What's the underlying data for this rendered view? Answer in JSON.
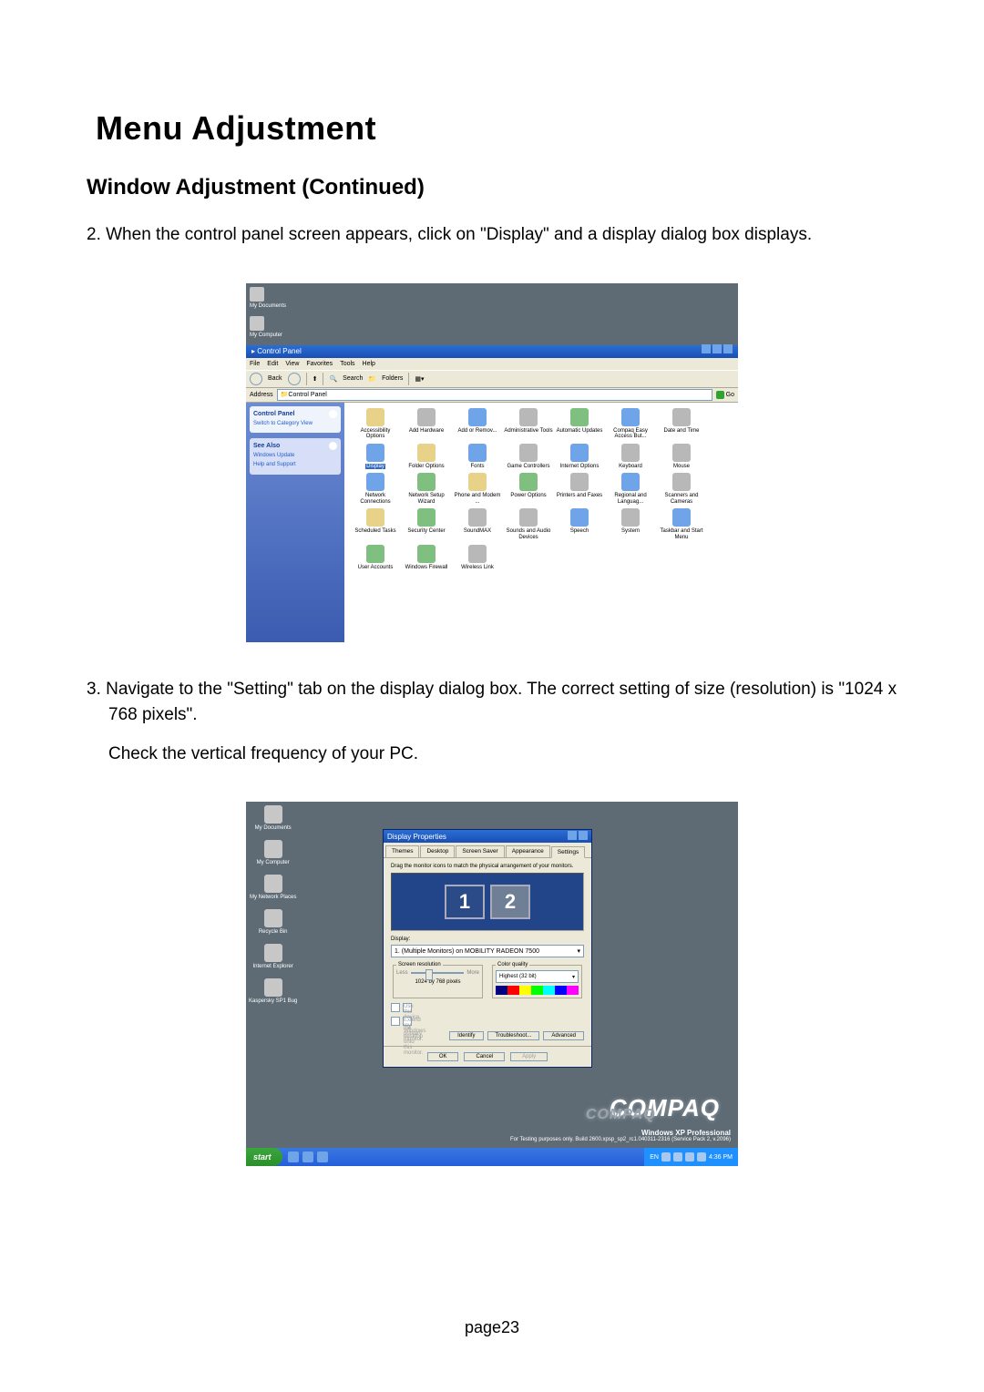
{
  "title": "Menu Adjustment",
  "subtitle": "Window Adjustment (Continued)",
  "step2": "2. When the control panel screen appears, click on \"Display\" and a display dialog box displays.",
  "step3": "3. Navigate to the \"Setting\" tab on the display dialog box. The correct setting of size (resolution) is \"1024 x 768 pixels\".",
  "step3b": "Check the vertical frequency of your PC.",
  "pagenum": "page23",
  "shot1": {
    "desktop": [
      "My Documents",
      "My Computer"
    ],
    "window_title": "Control Panel",
    "menu": [
      "File",
      "Edit",
      "View",
      "Favorites",
      "Tools",
      "Help"
    ],
    "toolbar": {
      "back": "Back",
      "search": "Search",
      "folders": "Folders"
    },
    "address_label": "Address",
    "address_value": "Control Panel",
    "go": "Go",
    "side_header": "Control Panel",
    "side_switch": "Switch to Category View",
    "see_also": "See Also",
    "see_items": [
      "Windows Update",
      "Help and Support"
    ],
    "icons": [
      "Accessibility Options",
      "Add Hardware",
      "Add or Remov...",
      "Administrative Tools",
      "Automatic Updates",
      "Compaq Easy Access But...",
      "Date and Time",
      "Display",
      "Folder Options",
      "Fonts",
      "Game Controllers",
      "Internet Options",
      "Keyboard",
      "Mouse",
      "Network Connections",
      "Network Setup Wizard",
      "Phone and Modem ...",
      "Power Options",
      "Printers and Faxes",
      "Regional and Languag...",
      "Scanners and Cameras",
      "Scheduled Tasks",
      "Security Center",
      "SoundMAX",
      "Sounds and Audio Devices",
      "Speech",
      "System",
      "Taskbar and Start Menu",
      "User Accounts",
      "Windows Firewall",
      "Wireless Link"
    ]
  },
  "shot2": {
    "desktop": [
      "My Documents",
      "My Computer",
      "My Network Places",
      "Recycle Bin",
      "Internet Explorer",
      "Kaspersky SP1 Bug"
    ],
    "dialog_title": "Display Properties",
    "tabs": [
      "Themes",
      "Desktop",
      "Screen Saver",
      "Appearance",
      "Settings"
    ],
    "hint": "Drag the monitor icons to match the physical arrangement of your monitors.",
    "mon1": "1",
    "mon2": "2",
    "display_label": "Display:",
    "display_value": "1. (Multiple Monitors) on MOBILITY RADEON 7500",
    "res_legend": "Screen resolution",
    "res_less": "Less",
    "res_more": "More",
    "res_value": "1024 by 768 pixels",
    "color_legend": "Color quality",
    "color_value": "Highest (32 bit)",
    "chk1": "Use this device as the primary monitor.",
    "chk2": "Extend my Windows desktop onto this monitor.",
    "identify": "Identify",
    "troubleshoot": "Troubleshoot...",
    "advanced": "Advanced",
    "ok": "OK",
    "cancel": "Cancel",
    "apply": "Apply",
    "brand": "COMPAQ",
    "brand_shadow": "COMPAQ",
    "winxp1": "Windows XP Professional",
    "winxp2": "For Testing purposes only. Build 2600.xpsp_sp2_rc1.040311-2316 (Service Pack 2, v.2096)",
    "start": "start",
    "clock": "4:36 PM",
    "tray_lang": "EN"
  }
}
